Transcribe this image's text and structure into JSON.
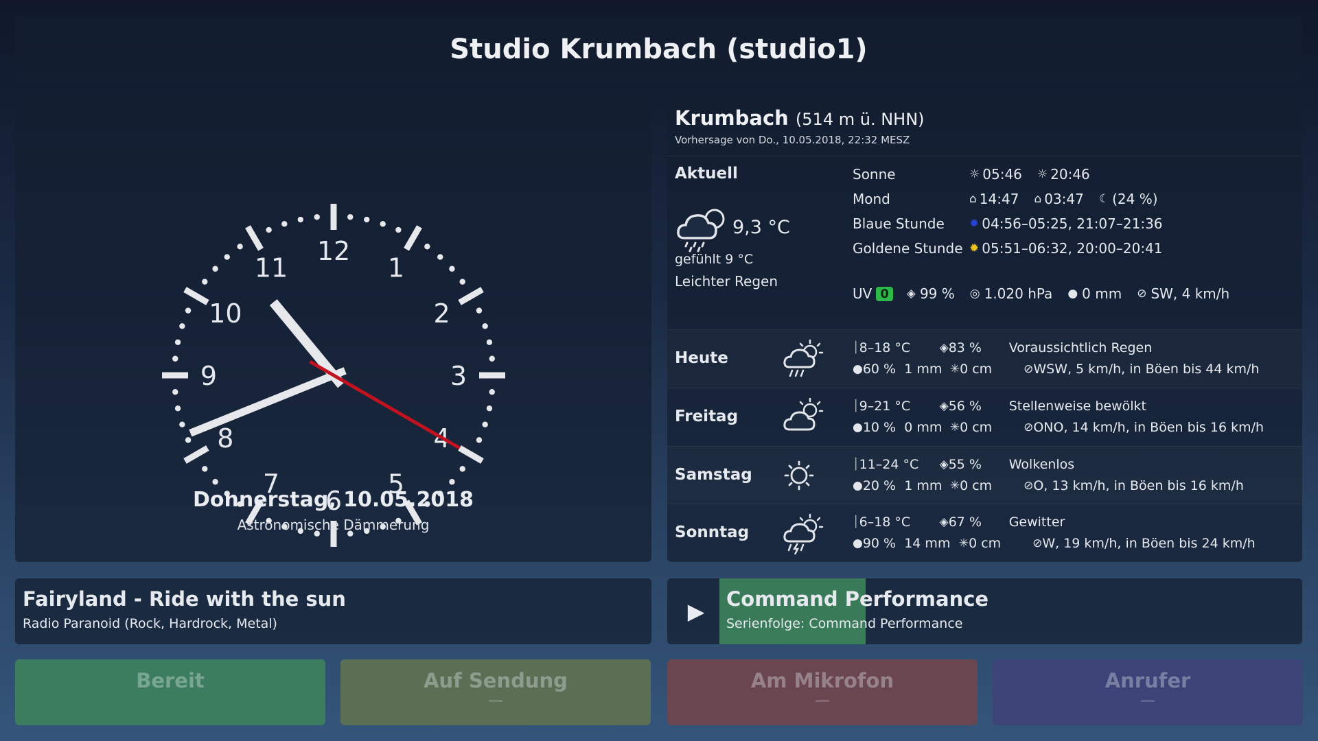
{
  "header": {
    "title": "Studio Krumbach (studio1)"
  },
  "clock": {
    "time": {
      "hour": 10,
      "minute": 41,
      "second": 20
    },
    "numerals": [
      "12",
      "1",
      "2",
      "3",
      "4",
      "5",
      "6",
      "7",
      "8",
      "9",
      "10",
      "11"
    ],
    "date": "Donnerstag, 10.05.2018",
    "phase": "Astronomische Dämmerung",
    "colors": {
      "hands": "#e6e8ec",
      "second_hand": "#c1121f"
    }
  },
  "weather": {
    "location": "Krumbach",
    "altitude": "(514 m ü. NHN)",
    "forecast_time": "Vorhersage von Do., 10.05.2018, 22:32 MESZ",
    "current": {
      "label": "Aktuell",
      "icon": "cloud-rain-icon",
      "temp": "9,3 °C",
      "felt": "gefühlt 9 °C",
      "desc": "Leichter Regen",
      "astro": {
        "sun_label": "Sonne",
        "sunrise": "05:46",
        "sunset": "20:46",
        "moon_label": "Mond",
        "moonrise": "14:47",
        "moonset": "03:47",
        "moon_phase": "(24 %)",
        "blue_label": "Blaue Stunde",
        "blue_value": "04:56–05:25, 21:07–21:36",
        "golden_label": "Goldene Stunde",
        "golden_value": "05:51–06:32, 20:00–20:41"
      },
      "uv_label": "UV",
      "uv_value": "0",
      "humidity": "99 %",
      "pressure": "1.020 hPa",
      "precip": "0 mm",
      "wind": "SW, 4 km/h",
      "colors": {
        "uv_badge": "#2db84a",
        "blue_hour": "#2a43d8",
        "golden_hour": "#f2c318"
      }
    },
    "days": [
      {
        "name": "Heute",
        "icon": "cloud-sun-rain-icon",
        "temp": "8–18 °C",
        "humidity": "83 %",
        "desc": "Voraussichtlich Regen",
        "rain_prob": "60 %",
        "rain": "1 mm",
        "snow": "0 cm",
        "wind": "WSW, 5 km/h, in Böen bis 44 km/h"
      },
      {
        "name": "Freitag",
        "icon": "cloud-sun-icon",
        "temp": "9–21 °C",
        "humidity": "56 %",
        "desc": "Stellenweise bewölkt",
        "rain_prob": "10 %",
        "rain": "0 mm",
        "snow": "0 cm",
        "wind": "ONO, 14 km/h, in Böen bis 16 km/h"
      },
      {
        "name": "Samstag",
        "icon": "sun-icon",
        "temp": "11–24 °C",
        "humidity": "55 %",
        "desc": "Wolkenlos",
        "rain_prob": "20 %",
        "rain": "1 mm",
        "snow": "0 cm",
        "wind": "O, 13 km/h, in Böen bis 16 km/h"
      },
      {
        "name": "Sonntag",
        "icon": "cloud-sun-storm-icon",
        "temp": "6–18 °C",
        "humidity": "67 %",
        "desc": "Gewitter",
        "rain_prob": "90 %",
        "rain": "14 mm",
        "snow": "0 cm",
        "wind": "W, 19 km/h, in Böen bis 24 km/h"
      }
    ]
  },
  "now_playing": {
    "title": "Fairyland - Ride with the sun",
    "subtitle": "Radio Paranoid (Rock, Hardrock, Metal)"
  },
  "next_show": {
    "title": "Command Performance",
    "subtitle": "Serienfolge: Command Performance",
    "progress": 0.23,
    "play_icon": "play-icon"
  },
  "status": {
    "ready": {
      "label": "Bereit",
      "value": ""
    },
    "onair": {
      "label": "Auf Sendung",
      "value": "—"
    },
    "mic": {
      "label": "Am Mikrofon",
      "value": "—"
    },
    "caller": {
      "label": "Anrufer",
      "value": "—"
    },
    "colors": {
      "ready": "#3c7d5f",
      "onair": "#5b6f55",
      "mic": "#6a4650",
      "caller": "#3b4377"
    }
  }
}
